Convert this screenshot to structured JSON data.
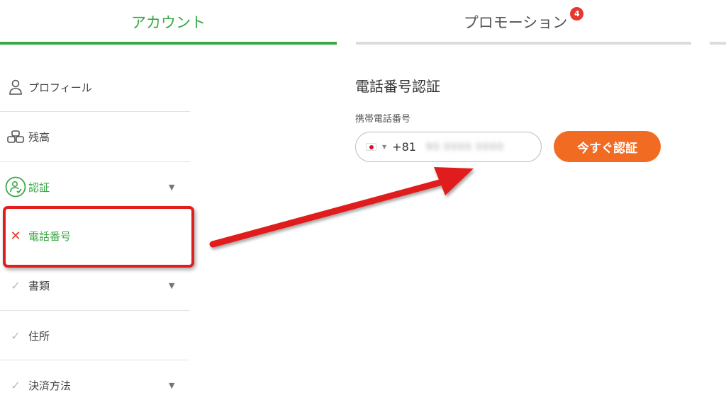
{
  "tabs": {
    "account": "アカウント",
    "promotion": "プロモーション",
    "promotion_badge": "4"
  },
  "sidebar": {
    "items": [
      {
        "label": "プロフィール",
        "icon": "person-icon"
      },
      {
        "label": "残高",
        "icon": "coins-icon"
      },
      {
        "label": "認証",
        "icon": "verified-user-icon"
      },
      {
        "label": "電話番号",
        "icon": "x-icon",
        "status": "unverified"
      },
      {
        "label": "書類",
        "icon": "check-icon"
      },
      {
        "label": "住所",
        "icon": "check-icon"
      },
      {
        "label": "決済方法",
        "icon": "check-icon"
      }
    ]
  },
  "main": {
    "title": "電話番号認証",
    "field_label": "携帯電話番号",
    "dial_code": "+81",
    "phone_masked": "90 0000 0000",
    "verify_button": "今すぐ認証"
  },
  "colors": {
    "accent_green": "#3aa845",
    "cta_orange": "#f26b23",
    "alert_red": "#e8372c"
  }
}
